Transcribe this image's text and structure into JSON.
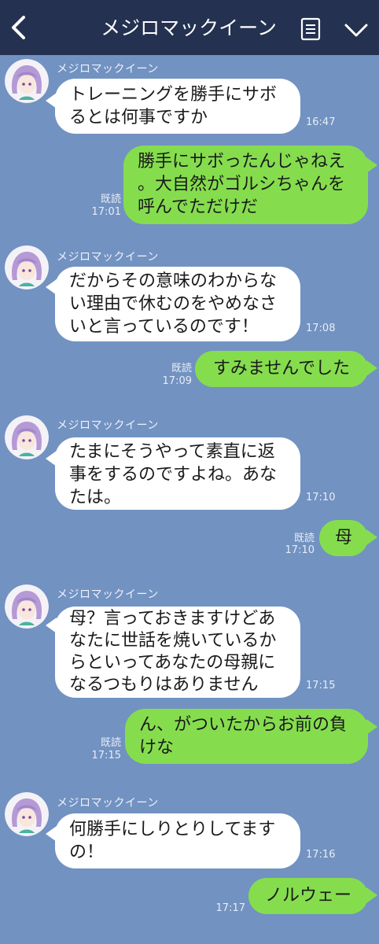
{
  "header": {
    "title": "メジロマックイーン"
  },
  "icons": {
    "back": "chevron-left-icon",
    "menu": "note-list-icon",
    "collapse": "chevron-down-icon"
  },
  "colors": {
    "header_bg": "#243150",
    "chat_bg": "#7292c1",
    "incoming_bubble": "#ffffff",
    "outgoing_bubble": "#85dd4e"
  },
  "messages": [
    {
      "sender": "メジロマックイーン",
      "text": "トレーニングを勝手にサボ\nるとは何事ですか",
      "time": "16:47"
    },
    {
      "read": "既読",
      "text": "勝手にサボったんじゃねえ\n。大自然がゴルシちゃんを\n呼んでただけだ",
      "time": "17:01"
    },
    {
      "sender": "メジロマックイーン",
      "text": "だからその意味のわからな\nい理由で休むのをやめなさ\nいと言っているのです！",
      "time": "17:08"
    },
    {
      "read": "既読",
      "text": "すみませんでした",
      "time": "17:09"
    },
    {
      "sender": "メジロマックイーン",
      "text": "たまにそうやって素直に返\n事をするのですよね。あな\nたは。",
      "time": "17:10"
    },
    {
      "read": "既読",
      "text": "母",
      "time": "17:10"
    },
    {
      "sender": "メジロマックイーン",
      "text": "母？言っておきますけどあ\nなたに世話を焼いているか\nらといってあなたの母親に\nなるつもりはありません",
      "time": "17:15"
    },
    {
      "read": "既読",
      "text": "ん、がついたからお前の負\nけな",
      "time": "17:15"
    },
    {
      "sender": "メジロマックイーン",
      "text": "何勝手にしりとりしてます\nの！",
      "time": "17:16"
    },
    {
      "text": "ノルウェー",
      "time": "17:17"
    }
  ]
}
